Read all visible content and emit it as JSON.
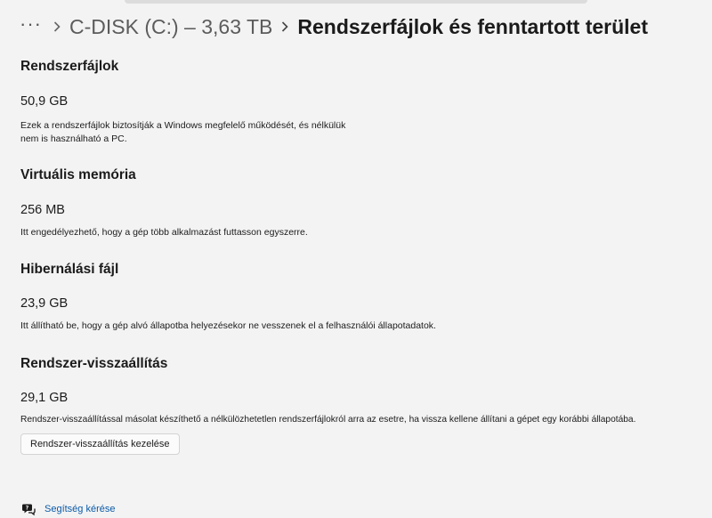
{
  "breadcrumb": {
    "more_label": "···",
    "parent": "C-DISK (C:) – 3,63 TB",
    "current": "Rendszerfájlok és fenntartott terület"
  },
  "sections": [
    {
      "title": "Rendszerfájlok",
      "value": "50,9 GB",
      "description": "Ezek a rendszerfájlok biztosítják a Windows megfelelő működését, és nélkülük nem is használható a PC."
    },
    {
      "title": "Virtuális memória",
      "value": "256 MB",
      "description": "Itt engedélyezhető, hogy a gép több alkalmazást futtasson egyszerre."
    },
    {
      "title": "Hibernálási fájl",
      "value": "23,9 GB",
      "description": "Itt állítható be, hogy a gép alvó állapotba helyezésekor ne vesszenek el a felhasználói állapotadatok."
    },
    {
      "title": "Rendszer-visszaállítás",
      "value": "29,1 GB",
      "description": "Rendszer-visszaállítással másolat készíthető a nélkülözhetetlen rendszerfájlokról arra az esetre, ha vissza kellene állítani a gépet egy korábbi állapotába."
    }
  ],
  "manage_button_label": "Rendszer-visszaállítás kezelése",
  "help": {
    "icon": "help-chat-icon",
    "label": "Segítség kérése"
  },
  "colors": {
    "background": "#f3f3f3",
    "link": "#0a5aa8"
  }
}
